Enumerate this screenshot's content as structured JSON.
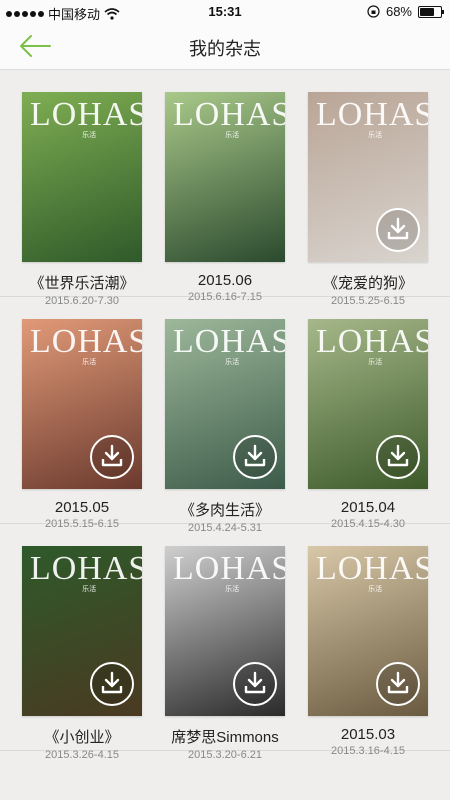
{
  "status_bar": {
    "carrier": "中国移动",
    "time": "15:31",
    "battery_percent": "68%",
    "battery_level": 0.68
  },
  "nav": {
    "title": "我的杂志",
    "back_icon": "back-arrow-icon",
    "accent_color": "#7cc04b"
  },
  "cover_logo": "LOHAS",
  "cover_logo_sub": "乐活",
  "magazines": [
    {
      "title": "《世界乐活潮》",
      "date": "2015.6.20-7.30",
      "colors": [
        "#2f5a2a",
        "#7fae52"
      ],
      "downloadable": false
    },
    {
      "title": "2015.06",
      "date": "2015.6.16-7.15",
      "colors": [
        "#2b4a2e",
        "#a9c98a"
      ],
      "downloadable": false
    },
    {
      "title": "《宠爱的狗》",
      "date": "2015.5.25-6.15",
      "colors": [
        "#d9d4cf",
        "#b9a596"
      ],
      "downloadable": true
    },
    {
      "title": "2015.05",
      "date": "2015.5.15-6.15",
      "colors": [
        "#6b3a2e",
        "#e19a78"
      ],
      "downloadable": true
    },
    {
      "title": "《多肉生活》",
      "date": "2015.4.24-5.31",
      "colors": [
        "#3d5b4a",
        "#9db89a"
      ],
      "downloadable": true
    },
    {
      "title": "2015.04",
      "date": "2015.4.15-4.30",
      "colors": [
        "#3d5a2a",
        "#a6b88a"
      ],
      "downloadable": true
    },
    {
      "title": "《小创业》",
      "date": "2015.3.26-4.15",
      "colors": [
        "#4a3a22",
        "#2e5a2a"
      ],
      "downloadable": true
    },
    {
      "title": "席梦思Simmons",
      "date": "2015.3.20-6.21",
      "colors": [
        "#2a2a2a",
        "#cfcfcf"
      ],
      "downloadable": true
    },
    {
      "title": "2015.03",
      "date": "2015.3.16-4.15",
      "colors": [
        "#6a5a40",
        "#d8c8a8"
      ],
      "downloadable": true
    }
  ]
}
